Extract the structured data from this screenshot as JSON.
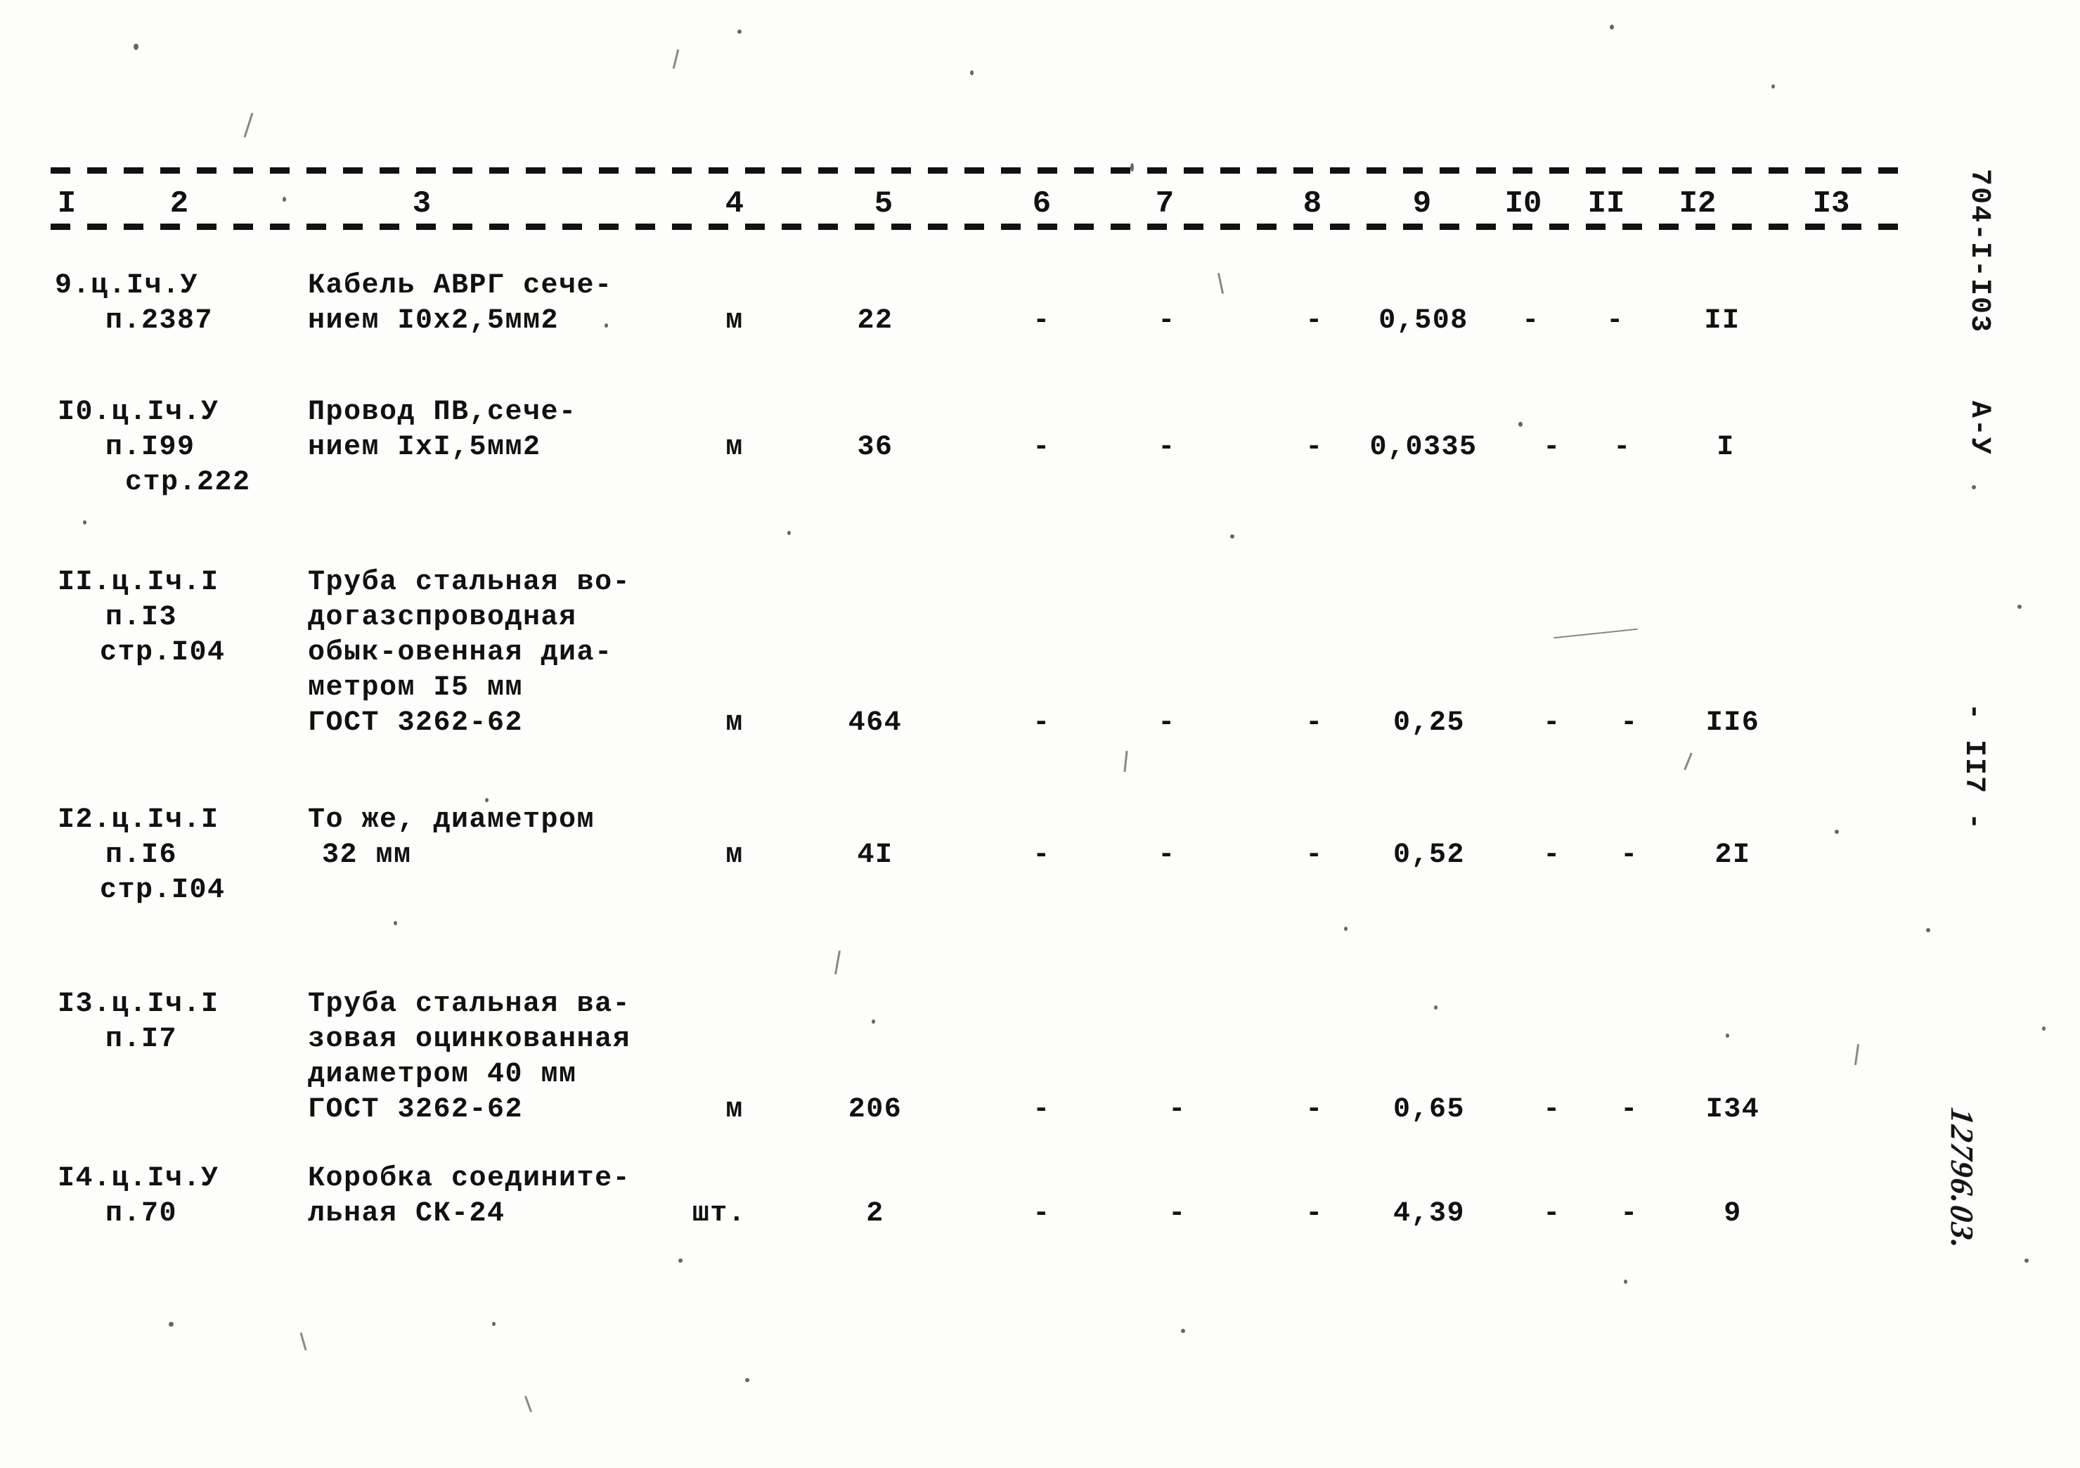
{
  "document": {
    "type": "specification-table",
    "page_number": "- II7 -",
    "document_code": "704-I-I03",
    "document_series": "А-У",
    "archive_stamp": "12796.03."
  },
  "table": {
    "column_headers": [
      "I",
      "2",
      "3",
      "4",
      "5",
      "6",
      "7",
      "8",
      "9",
      "I0",
      "II",
      "I2",
      "I3"
    ],
    "rows": [
      {
        "code": [
          "9.ц.Iч.У",
          "п.2387"
        ],
        "description": [
          "Кабель АВРГ сече-",
          "нием I0x2,5мм2"
        ],
        "unit": "м",
        "c5": "22",
        "c6": "-",
        "c7": "-",
        "c8": "-",
        "c9": "0,508",
        "c10": "-",
        "c11": "-",
        "c12": "II",
        "c13": ""
      },
      {
        "code": [
          "I0.ц.Iч.У",
          "п.I99",
          "стр.222"
        ],
        "description": [
          "Провод ПВ,сече-",
          "нием IxI,5мм2"
        ],
        "unit": "м",
        "c5": "36",
        "c6": "-",
        "c7": "-",
        "c8": "-",
        "c9": "0,0335",
        "c10": "-",
        "c11": "-",
        "c12": "I",
        "c13": ""
      },
      {
        "code": [
          "II.ц.Iч.I",
          "п.I3",
          "стр.I04"
        ],
        "description": [
          "Труба стальная во-",
          "догазспроводная",
          "обык-овенная диа-",
          "метром I5 мм",
          "ГОСТ 3262-62"
        ],
        "unit": "м",
        "c5": "464",
        "c6": "-",
        "c7": "-",
        "c8": "-",
        "c9": "0,25",
        "c10": "-",
        "c11": "-",
        "c12": "II6",
        "c13": ""
      },
      {
        "code": [
          "I2.ц.Iч.I",
          "п.I6",
          "стр.I04"
        ],
        "description": [
          "То же, диаметром",
          "32 мм"
        ],
        "unit": "м",
        "c5": "4I",
        "c6": "-",
        "c7": "-",
        "c8": "-",
        "c9": "0,52",
        "c10": "-",
        "c11": "-",
        "c12": "2I",
        "c13": ""
      },
      {
        "code": [
          "I3.ц.Iч.I",
          "п.I7"
        ],
        "description": [
          "Труба стальная ва-",
          "зовая оцинкованная",
          "диаметром 40 мм",
          "ГОСТ 3262-62"
        ],
        "unit": "м",
        "c5": "206",
        "c6": "-",
        "c7": "-",
        "c8": "-",
        "c9": "0,65",
        "c10": "-",
        "c11": "-",
        "c12": "I34",
        "c13": ""
      },
      {
        "code": [
          "I4.ц.Iч.У",
          "п.70"
        ],
        "description": [
          "Коробка соедините-",
          "льная СК-24"
        ],
        "unit": "шт.",
        "c5": "2",
        "c6": "-",
        "c7": "-",
        "c8": "-",
        "c9": "4,39",
        "c10": "-",
        "c11": "-",
        "c12": "9",
        "c13": ""
      }
    ]
  }
}
